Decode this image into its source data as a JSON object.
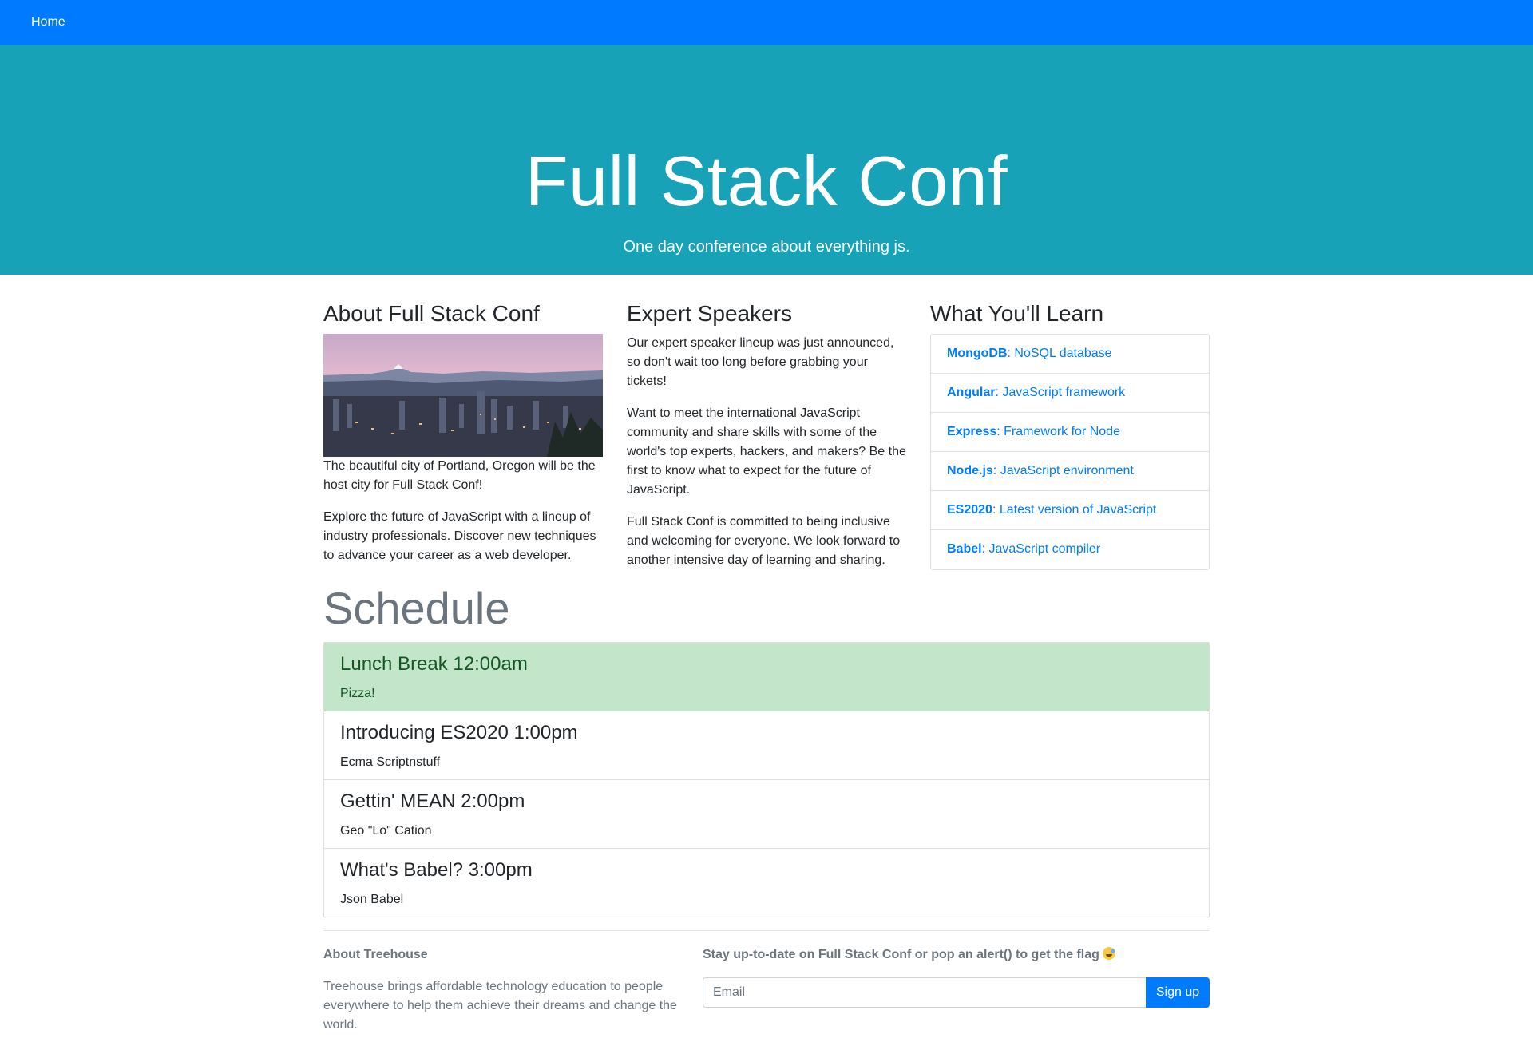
{
  "nav": {
    "home_label": "Home"
  },
  "hero": {
    "title": "Full Stack Conf",
    "subtitle": "One day conference about everything js."
  },
  "about": {
    "heading": "About Full Stack Conf",
    "image_alt": "Portland skyline with mountain",
    "para1": "The beautiful city of Portland, Oregon will be the host city for Full Stack Conf!",
    "para2": "Explore the future of JavaScript with a lineup of industry professionals. Discover new techniques to advance your career as a web developer."
  },
  "speakers": {
    "heading": "Expert Speakers",
    "para1": "Our expert speaker lineup was just announced, so don't wait too long before grabbing your tickets!",
    "para2": "Want to meet the international JavaScript community and share skills with some of the world's top experts, hackers, and makers? Be the first to know what to expect for the future of JavaScript.",
    "para3": "Full Stack Conf is committed to being inclusive and welcoming for everyone. We look forward to another intensive day of learning and sharing."
  },
  "learn": {
    "heading": "What You'll Learn",
    "items": [
      {
        "name": "MongoDB",
        "desc": ": NoSQL database"
      },
      {
        "name": "Angular",
        "desc": ": JavaScript framework"
      },
      {
        "name": "Express",
        "desc": ": Framework for Node"
      },
      {
        "name": "Node.js",
        "desc": ": JavaScript environment"
      },
      {
        "name": "ES2020",
        "desc": ": Latest version of JavaScript"
      },
      {
        "name": "Babel",
        "desc": ": JavaScript compiler"
      }
    ]
  },
  "schedule": {
    "heading": "Schedule",
    "items": [
      {
        "title": "Lunch Break 12:00am",
        "detail": "Pizza!"
      },
      {
        "title": "Introducing ES2020 1:00pm",
        "detail": "Ecma Scriptnstuff"
      },
      {
        "title": "Gettin' MEAN 2:00pm",
        "detail": "Geo \"Lo\" Cation"
      },
      {
        "title": "What's Babel? 3:00pm",
        "detail": "Json Babel"
      }
    ]
  },
  "footer": {
    "about_heading": "About Treehouse",
    "about_text": "Treehouse brings affordable technology education to people everywhere to help them achieve their dreams and change the world.",
    "signup_heading": "Stay up-to-date on Full Stack Conf or pop an alert() to get the flag",
    "emoji_icon": "sweat-smile-emoji-icon",
    "email_placeholder": "Email",
    "signup_label": "Sign up"
  }
}
